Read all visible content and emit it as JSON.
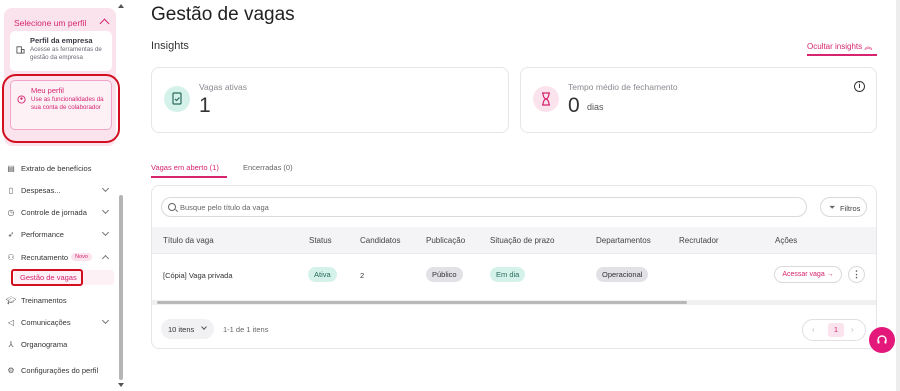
{
  "sidebar": {
    "profile_header": "Selecione um perfil",
    "options": [
      {
        "title": "Perfil da empresa",
        "desc": "Acesse as ferramentas de gestão da empresa"
      },
      {
        "title": "Meu perfil",
        "desc": "Use as funcionalidades da sua conta de colaborador"
      }
    ],
    "items": [
      {
        "label": "Extrato de benefícios"
      },
      {
        "label": "Despesas..."
      },
      {
        "label": "Controle de jornada"
      },
      {
        "label": "Performance"
      },
      {
        "label": "Recrutamento",
        "badge": "Novo"
      },
      {
        "label": "Gestão de vagas"
      },
      {
        "label": "Treinamentos"
      },
      {
        "label": "Comunicações"
      },
      {
        "label": "Organograma"
      },
      {
        "label": "Configurações do perfil"
      }
    ]
  },
  "main": {
    "page_title": "Gestão de vagas",
    "insights_title": "Insights",
    "hide_insights": "Ocultar insights",
    "cards": [
      {
        "label": "Vagas ativas",
        "value": "1",
        "unit": ""
      },
      {
        "label": "Tempo médio de fechamento",
        "value": "0",
        "unit": "dias"
      }
    ],
    "tabs": [
      {
        "label": "Vagas em aberto (1)"
      },
      {
        "label": "Encerradas (0)"
      }
    ],
    "search_placeholder": "Busque pelo título da vaga",
    "filter_label": "Filtros",
    "columns": [
      "Título da vaga",
      "Status",
      "Candidatos",
      "Publicação",
      "Situação de prazo",
      "Departamentos",
      "Recrutador",
      "Ações"
    ],
    "rows": [
      {
        "title": "[Cópia] Vaga privada",
        "status": "Ativa",
        "candidates": "2",
        "publication": "Público",
        "deadline": "Em dia",
        "department": "Operacional",
        "recruiter": "",
        "action": "Acessar vaga →"
      }
    ],
    "per_page": "10 itens",
    "range_text": "1-1 de 1 itens",
    "current_page": "1"
  },
  "colors": {
    "accent": "#d6246e",
    "annotation": "#d10f1f",
    "success_bg": "#d5f2ea"
  }
}
